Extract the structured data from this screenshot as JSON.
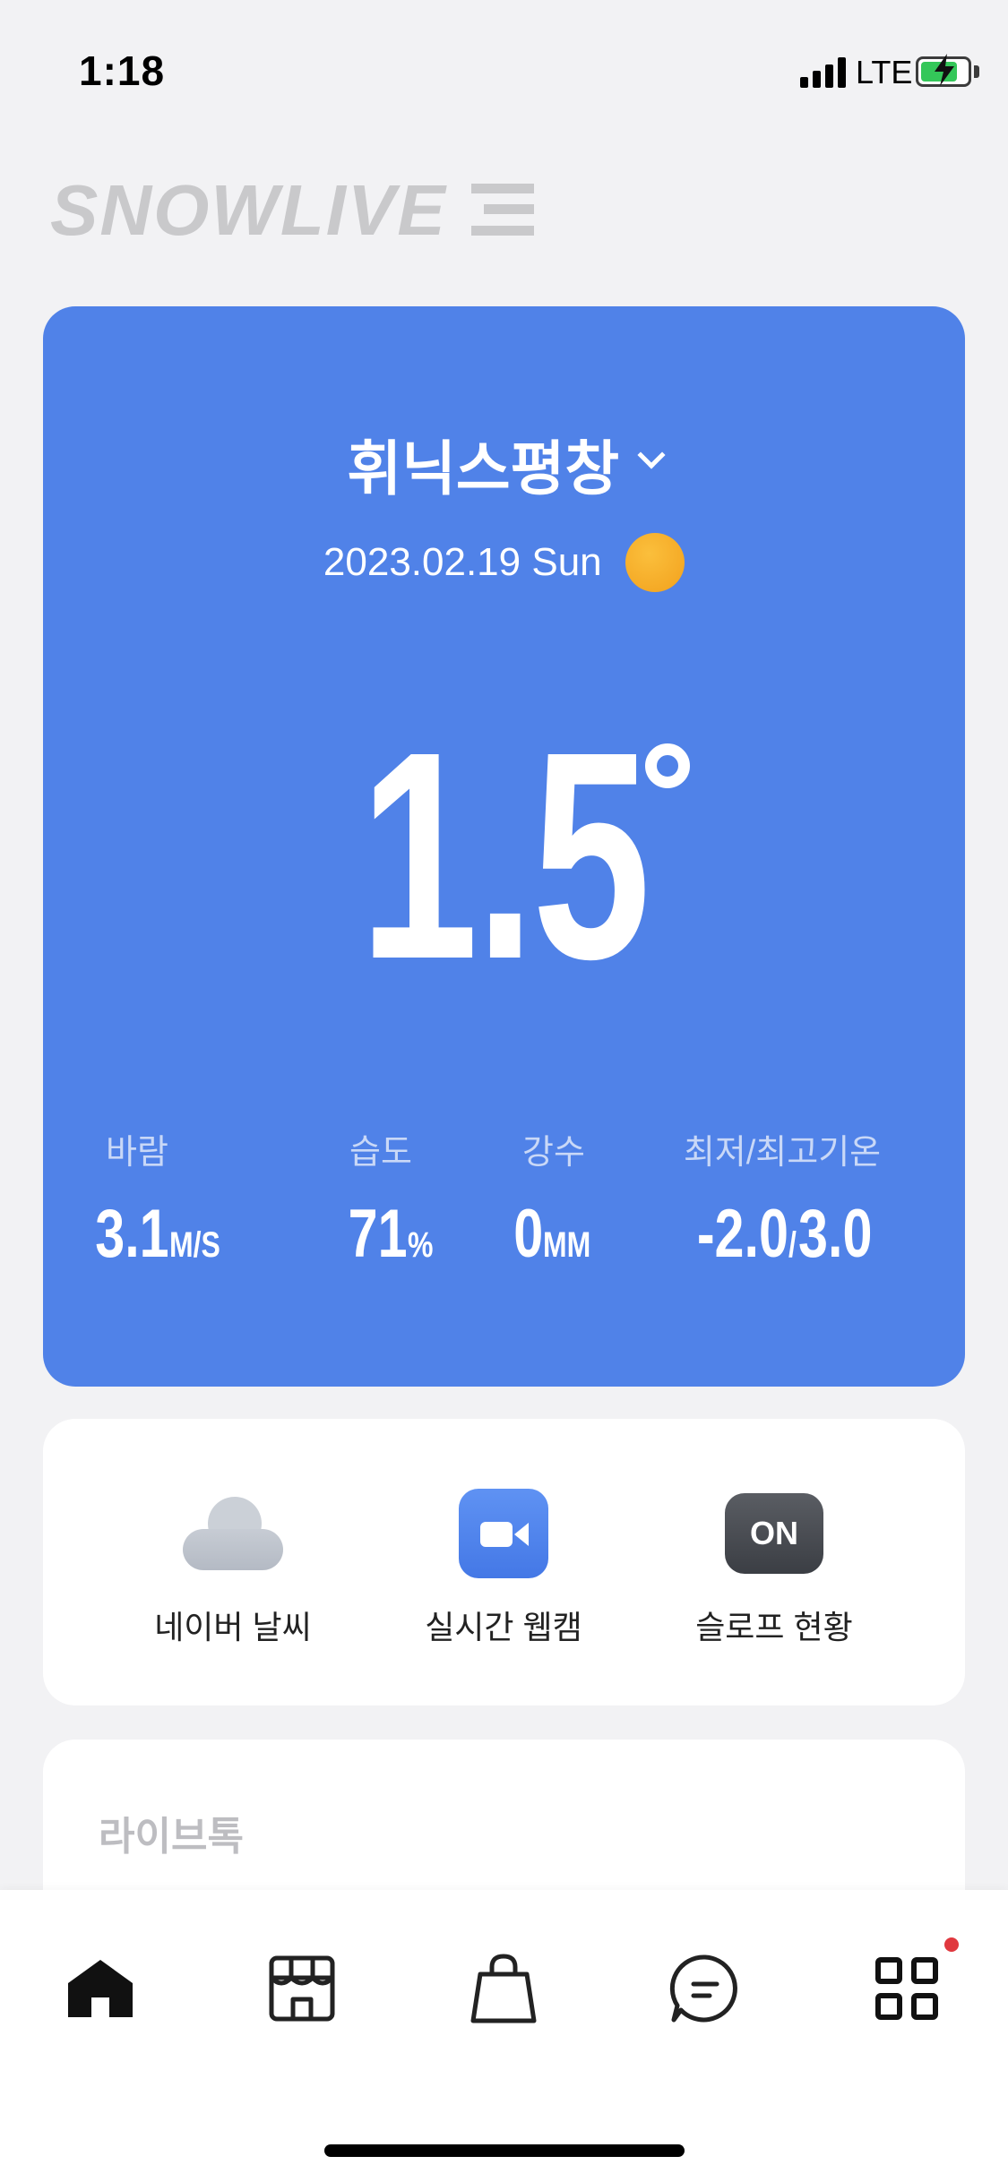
{
  "status_bar": {
    "time": "1:18",
    "network": "LTE",
    "battery_level": 0.8
  },
  "logo": {
    "text": "SNOWLIVE"
  },
  "weather": {
    "resort_name": "휘닉스평창",
    "date": "2023.02.19 Sun",
    "temperature": "1.5",
    "stats": [
      {
        "label": "바람",
        "value": "3.1",
        "unit": "M/S"
      },
      {
        "label": "습도",
        "value": "71",
        "unit": "%"
      },
      {
        "label": "강수",
        "value": "0",
        "unit": "MM"
      },
      {
        "label": "최저/최고기온",
        "value": "-2.0",
        "unit": "/",
        "value2": "3.0"
      }
    ]
  },
  "quick_links": [
    {
      "label": "네이버 날씨",
      "icon": "cloud-icon"
    },
    {
      "label": "실시간 웹캠",
      "icon": "webcam-icon"
    },
    {
      "label": "슬로프 현황",
      "icon": "on-icon",
      "icon_text": "ON"
    }
  ],
  "live_talk": {
    "title": "라이브톡"
  },
  "bottom_nav": [
    {
      "icon": "home-icon",
      "active": true
    },
    {
      "icon": "store-icon",
      "active": false
    },
    {
      "icon": "shopping-bag-icon",
      "active": false
    },
    {
      "icon": "chat-icon",
      "active": false
    },
    {
      "icon": "grid-menu-icon",
      "active": false,
      "badge": true
    }
  ],
  "colors": {
    "card_blue": "#5082e8",
    "background": "#f2f2f4",
    "badge_red": "#e0383e"
  }
}
